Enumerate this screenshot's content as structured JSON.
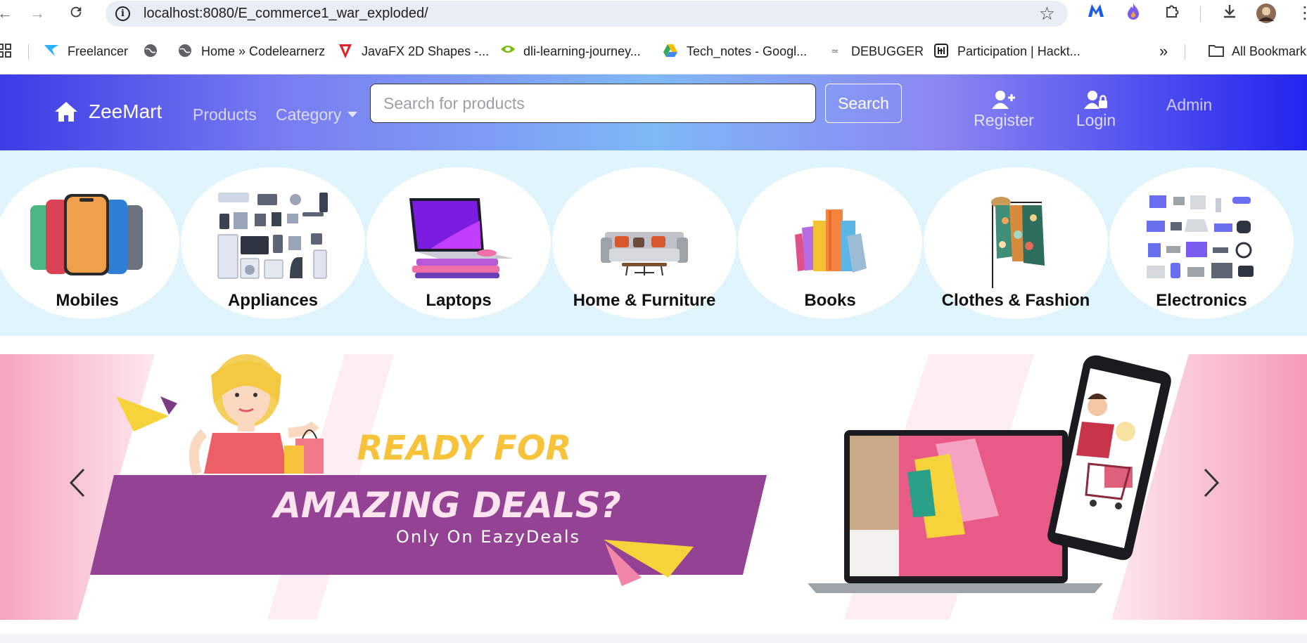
{
  "browser": {
    "url": "localhost:8080/E_commerce1_war_exploded/",
    "bookmarks": [
      {
        "label": "Freelancer",
        "icon": "freelancer-icon"
      },
      {
        "label": "",
        "icon": "globe-icon"
      },
      {
        "label": "Home » Codelearnerz",
        "icon": "globe-icon"
      },
      {
        "label": "JavaFX 2D Shapes -...",
        "icon": "tutorials-point-icon"
      },
      {
        "label": "dli-learning-journey...",
        "icon": "nvidia-icon"
      },
      {
        "label": "Tech_notes - Googl...",
        "icon": "google-drive-icon"
      },
      {
        "label": "DEBUGGER",
        "icon": "debugger-icon"
      },
      {
        "label": "Participation | Hackt...",
        "icon": "hackathon-icon"
      }
    ],
    "more_bookmarks": "»",
    "all_bookmarks": "All Bookmarks"
  },
  "navbar": {
    "brand": "ZeeMart",
    "products": "Products",
    "category": "Category",
    "search_placeholder": "Search for products",
    "search_button": "Search",
    "register": "Register",
    "login": "Login",
    "admin": "Admin"
  },
  "categories": [
    {
      "label": "Mobiles",
      "icon": "mobiles-image"
    },
    {
      "label": "Appliances",
      "icon": "appliances-image"
    },
    {
      "label": "Laptops",
      "icon": "laptops-image"
    },
    {
      "label": "Home & Furniture",
      "icon": "sofa-image"
    },
    {
      "label": "Books",
      "icon": "books-image"
    },
    {
      "label": "Clothes & Fashion",
      "icon": "clothes-image"
    },
    {
      "label": "Electronics",
      "icon": "electronics-image"
    }
  ],
  "banner": {
    "line1": "READY FOR",
    "line2": "AMAZING DEALS?",
    "line3": "Only On EazyDeals"
  },
  "colors": {
    "navbar_start": "#3d3be6",
    "navbar_mid": "#7fb8f5",
    "navbar_end": "#2424ee",
    "category_bg": "#e0f5fb",
    "banner_purple": "#944394",
    "banner_yellow": "#f8c93a",
    "banner_pink": "#f59ab7"
  }
}
